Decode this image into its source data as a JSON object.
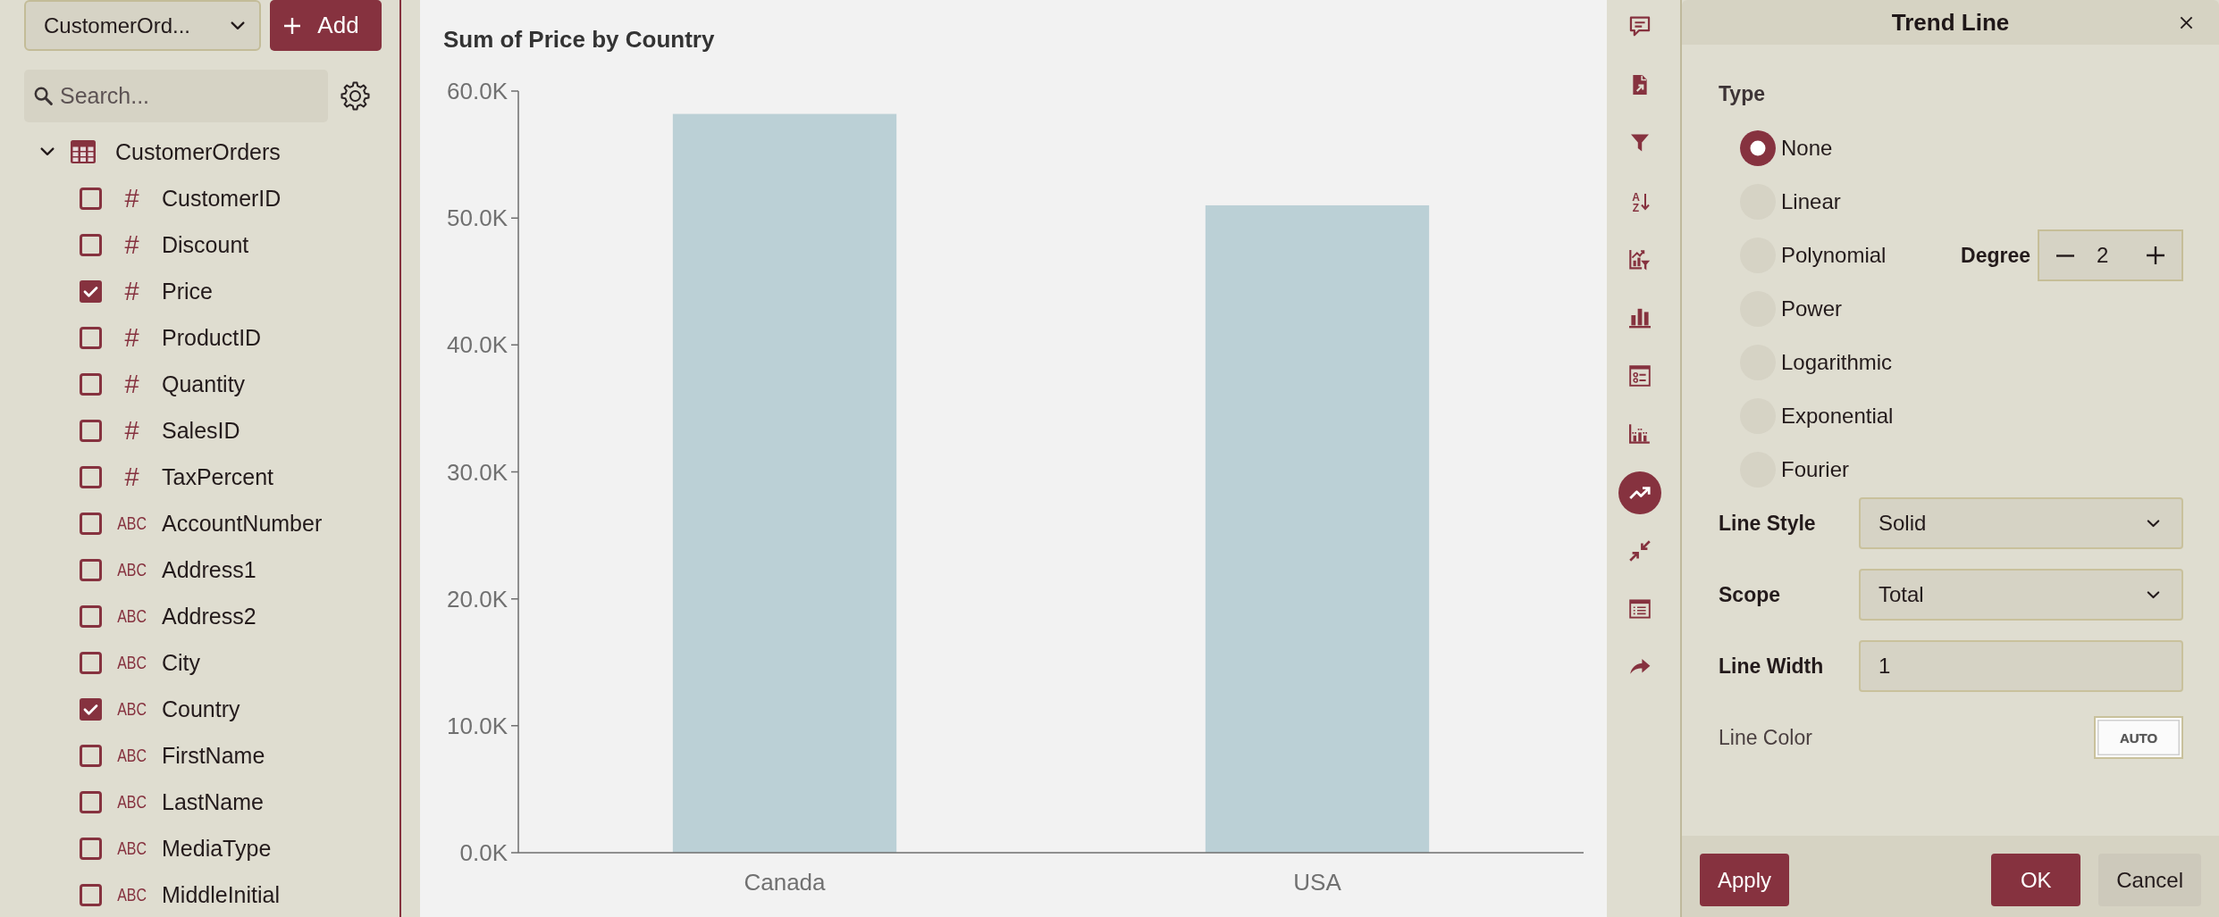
{
  "sidebar": {
    "source_select": {
      "value": "CustomerOrd..."
    },
    "add_button": {
      "label": "Add"
    },
    "search": {
      "placeholder": "Search..."
    },
    "tree": [
      {
        "label": "CustomerOrders",
        "expanded": true,
        "children": [
          {
            "label": "CustomerID",
            "kind": "number",
            "type_mark": "#",
            "checked": false
          },
          {
            "label": "Discount",
            "kind": "number",
            "type_mark": "#",
            "checked": false
          },
          {
            "label": "Price",
            "kind": "number",
            "type_mark": "#",
            "checked": true
          },
          {
            "label": "ProductID",
            "kind": "number",
            "type_mark": "#",
            "checked": false
          },
          {
            "label": "Quantity",
            "kind": "number",
            "type_mark": "#",
            "checked": false
          },
          {
            "label": "SalesID",
            "kind": "number",
            "type_mark": "#",
            "checked": false
          },
          {
            "label": "TaxPercent",
            "kind": "number",
            "type_mark": "#",
            "checked": false
          },
          {
            "label": "AccountNumber",
            "kind": "text",
            "type_mark": "ABC",
            "checked": false
          },
          {
            "label": "Address1",
            "kind": "text",
            "type_mark": "ABC",
            "checked": false
          },
          {
            "label": "Address2",
            "kind": "text",
            "type_mark": "ABC",
            "checked": false
          },
          {
            "label": "City",
            "kind": "text",
            "type_mark": "ABC",
            "checked": false
          },
          {
            "label": "Country",
            "kind": "text",
            "type_mark": "ABC",
            "checked": true
          },
          {
            "label": "FirstName",
            "kind": "text",
            "type_mark": "ABC",
            "checked": false
          },
          {
            "label": "LastName",
            "kind": "text",
            "type_mark": "ABC",
            "checked": false
          },
          {
            "label": "MediaType",
            "kind": "text",
            "type_mark": "ABC",
            "checked": false
          },
          {
            "label": "MiddleInitial",
            "kind": "text",
            "type_mark": "ABC",
            "checked": false
          }
        ]
      }
    ]
  },
  "chart": {
    "chart_data": {
      "type": "bar",
      "title": "Sum of Price by Country",
      "categories": [
        "Canada",
        "USA"
      ],
      "values": [
        58200,
        51000
      ],
      "ylim": [
        0,
        60000
      ],
      "yticks": [
        {
          "value": 0,
          "label": "0.0K"
        },
        {
          "value": 10000,
          "label": "10.0K"
        },
        {
          "value": 20000,
          "label": "20.0K"
        },
        {
          "value": 30000,
          "label": "30.0K"
        },
        {
          "value": 40000,
          "label": "40.0K"
        },
        {
          "value": 50000,
          "label": "50.0K"
        },
        {
          "value": 60000,
          "label": "60.0K"
        }
      ]
    }
  },
  "toolbar": [
    {
      "kind": "comment",
      "selected": false
    },
    {
      "kind": "export",
      "selected": false
    },
    {
      "kind": "filter",
      "selected": false
    },
    {
      "kind": "sort",
      "letters": [
        "A",
        "Z"
      ],
      "selected": false
    },
    {
      "kind": "chart-filter",
      "selected": false
    },
    {
      "kind": "bar-chart",
      "selected": false
    },
    {
      "kind": "legend",
      "selected": false
    },
    {
      "kind": "error-bars",
      "selected": false
    },
    {
      "kind": "trend-line",
      "selected": true
    },
    {
      "kind": "shrink",
      "selected": false
    },
    {
      "kind": "data-table",
      "selected": false
    },
    {
      "kind": "share",
      "selected": false
    }
  ],
  "trend_panel": {
    "title": "Trend Line",
    "type_label": "Type",
    "options": [
      {
        "label": "None",
        "selected": true
      },
      {
        "label": "Linear",
        "selected": false
      },
      {
        "label": "Polynomial",
        "selected": false,
        "degree": {
          "label": "Degree",
          "value": "2"
        }
      },
      {
        "label": "Power",
        "selected": false
      },
      {
        "label": "Logarithmic",
        "selected": false
      },
      {
        "label": "Exponential",
        "selected": false
      },
      {
        "label": "Fourier",
        "selected": false
      }
    ],
    "fields": [
      {
        "kind": "select",
        "label": "Line Style",
        "value": "Solid"
      },
      {
        "kind": "select",
        "label": "Scope",
        "value": "Total"
      },
      {
        "kind": "input",
        "label": "Line Width",
        "value": "1"
      },
      {
        "kind": "color",
        "label": "Line Color",
        "value": "AUTO"
      }
    ],
    "footer": {
      "start": [
        {
          "label": "Apply",
          "kind": "primary"
        }
      ],
      "end": [
        {
          "label": "OK",
          "kind": "primary"
        },
        {
          "label": "Cancel",
          "kind": "secondary"
        }
      ]
    }
  }
}
